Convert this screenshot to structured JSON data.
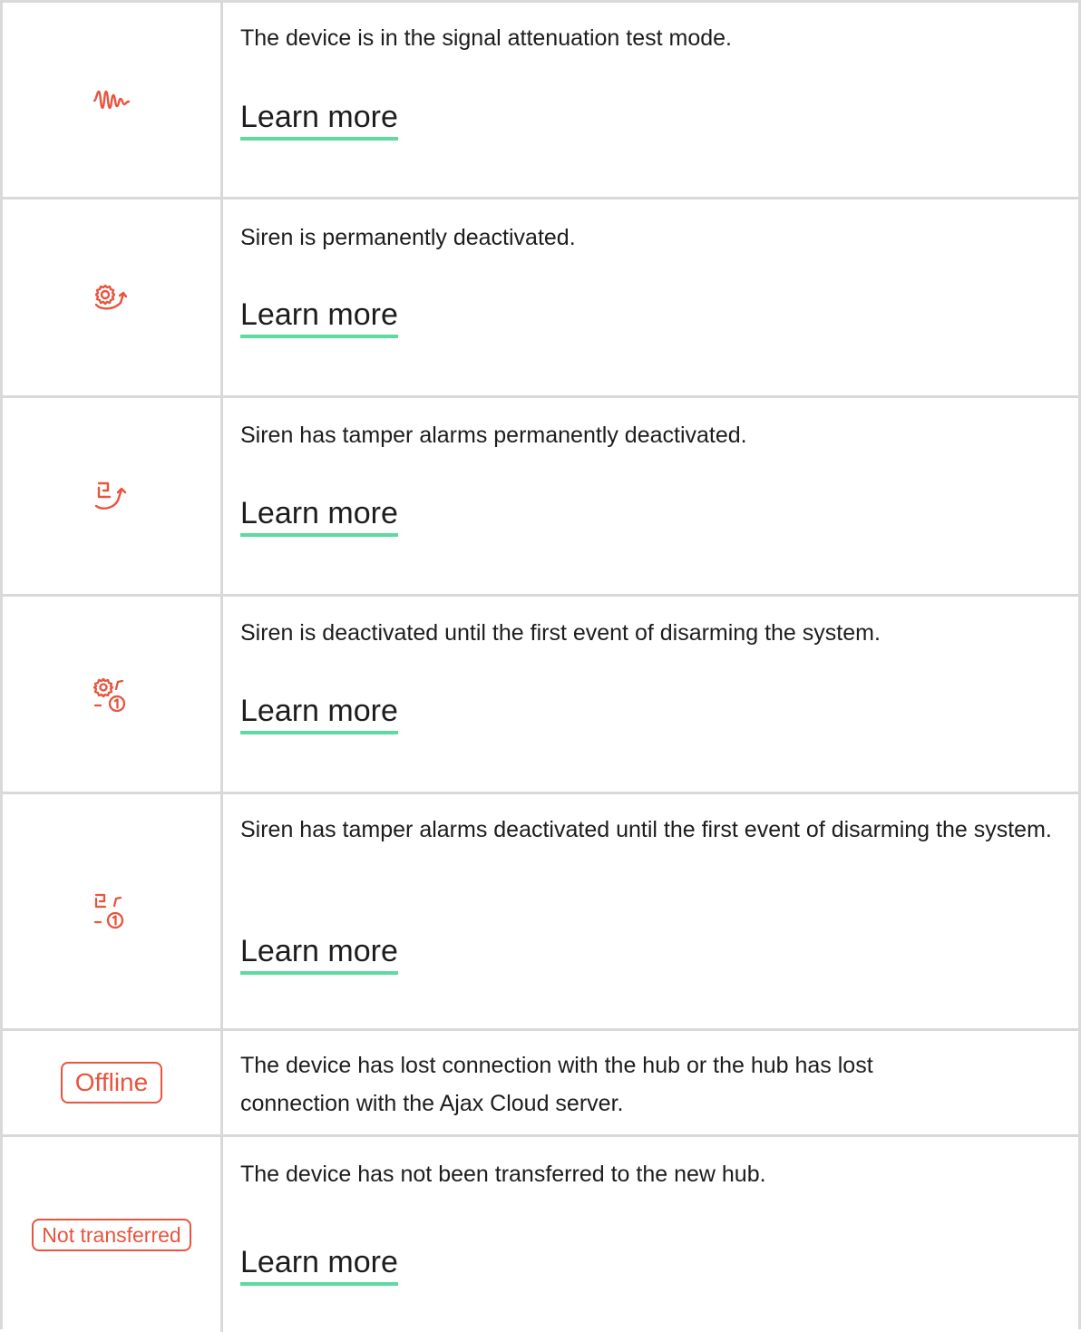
{
  "colors": {
    "accent": "#e8543e",
    "link_underline": "#5cdb9f",
    "border": "#d9d9d9",
    "text": "#1d1d1d"
  },
  "rows": [
    {
      "icon": "signal-attenuation-test-icon",
      "description": "The device is in the signal attenuation test mode.",
      "link": "Learn more"
    },
    {
      "icon": "siren-permanently-deactivated-icon",
      "description": "Siren is permanently deactivated.",
      "link": "Learn more"
    },
    {
      "icon": "tamper-permanently-deactivated-icon",
      "description": "Siren has tamper alarms permanently deactivated.",
      "link": "Learn more"
    },
    {
      "icon": "siren-deactivated-until-disarm-icon",
      "description": "Siren is deactivated until the first event of disarming the system.",
      "link": "Learn more"
    },
    {
      "icon": "tamper-deactivated-until-disarm-icon",
      "description": "Siren has tamper alarms deactivated until the first event of disarming the system.",
      "link": "Learn more"
    },
    {
      "badge": "Offline",
      "description": "The device has lost connection with the hub or the hub has lost connection with the Ajax Cloud server."
    },
    {
      "badge": "Not transferred",
      "description": "The device has not been transferred to the new hub.",
      "link": "Learn more"
    }
  ]
}
